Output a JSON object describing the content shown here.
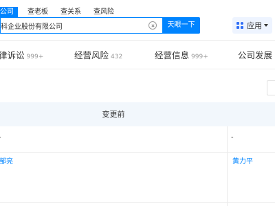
{
  "header": {
    "search_tabs": [
      {
        "label": "公司",
        "active": true
      },
      {
        "label": "查老板",
        "active": false
      },
      {
        "label": "查关系",
        "active": false
      },
      {
        "label": "查风险",
        "active": false
      }
    ],
    "search": {
      "value": "科企业股份有限公司",
      "button_label": "天眼一下"
    },
    "apps_button_label": "应用"
  },
  "category_tabs": [
    {
      "label": "律诉讼",
      "count": "999+"
    },
    {
      "label": "经营风险",
      "count": "432"
    },
    {
      "label": "经营信息",
      "count": "999+"
    },
    {
      "label": "公司发展",
      "count": ""
    }
  ],
  "table": {
    "header_before": "变更前",
    "rows": [
      {
        "before": "-",
        "after": "-",
        "style": "plain"
      },
      {
        "before": "邹亮",
        "after": "黄力平",
        "style": "link"
      }
    ]
  },
  "colors": {
    "accent": "#0084ff",
    "header_bg": "#f2f7fc",
    "apps_bg": "#eef4ff",
    "muted": "#999999"
  }
}
